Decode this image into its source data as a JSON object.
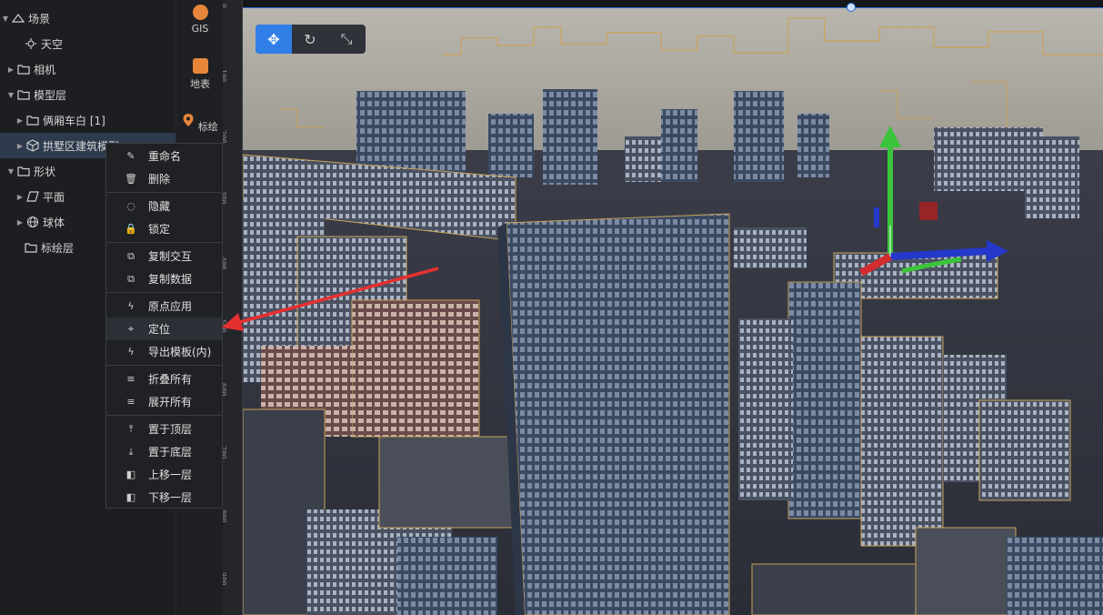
{
  "tree": {
    "items": [
      {
        "label": "场景",
        "caret": "▼",
        "icon": "scene-icon"
      },
      {
        "label": "天空",
        "caret": "",
        "icon": "sky-icon"
      },
      {
        "label": "相机",
        "caret": "▶",
        "icon": "folder-icon"
      },
      {
        "label": "模型层",
        "caret": "▼",
        "icon": "folder-icon"
      },
      {
        "label": "俩厢车白 [1]",
        "caret": "▶",
        "icon": "folder-icon"
      },
      {
        "label": "拱墅区建筑模型",
        "caret": "▶",
        "icon": "cube-icon"
      },
      {
        "label": "形状",
        "caret": "▼",
        "icon": "folder-icon"
      },
      {
        "label": "平面",
        "caret": "▶",
        "icon": "plane-icon"
      },
      {
        "label": "球体",
        "caret": "▶",
        "icon": "globe-icon"
      },
      {
        "label": "标绘层",
        "caret": "",
        "icon": "folder-icon"
      }
    ]
  },
  "tools": {
    "gis": "GIS",
    "surface": "地表",
    "plot": "标绘"
  },
  "ruler": {
    "ticks": [
      "0",
      "100",
      "200",
      "300",
      "400",
      "500",
      "600",
      "700",
      "800",
      "900"
    ]
  },
  "gizmo_tools": {
    "move": "✥",
    "rotate": "↻",
    "scale": "⤡"
  },
  "context_menu": {
    "items": [
      {
        "label": "重命名",
        "icon": "✎"
      },
      {
        "label": "删除",
        "icon": "🗑"
      },
      {
        "label": "隐藏",
        "icon": "◌"
      },
      {
        "label": "锁定",
        "icon": "🔒"
      },
      {
        "label": "复制交互",
        "icon": "⧉"
      },
      {
        "label": "复制数据",
        "icon": "⧉"
      },
      {
        "label": "原点应用",
        "icon": "ϟ"
      },
      {
        "label": "定位",
        "icon": "⌖"
      },
      {
        "label": "导出模板(内)",
        "icon": "ϟ"
      },
      {
        "label": "折叠所有",
        "icon": "≡"
      },
      {
        "label": "展开所有",
        "icon": "≡"
      },
      {
        "label": "置于顶层",
        "icon": "⤒"
      },
      {
        "label": "置于底层",
        "icon": "⤓"
      },
      {
        "label": "上移一层",
        "icon": "◧"
      },
      {
        "label": "下移一层",
        "icon": "◧"
      }
    ]
  },
  "colors": {
    "accent": "#2f7fe6",
    "tool_orange": "#e6863b",
    "arrow_red": "#e53030",
    "building_outline": "#c9a35a"
  }
}
